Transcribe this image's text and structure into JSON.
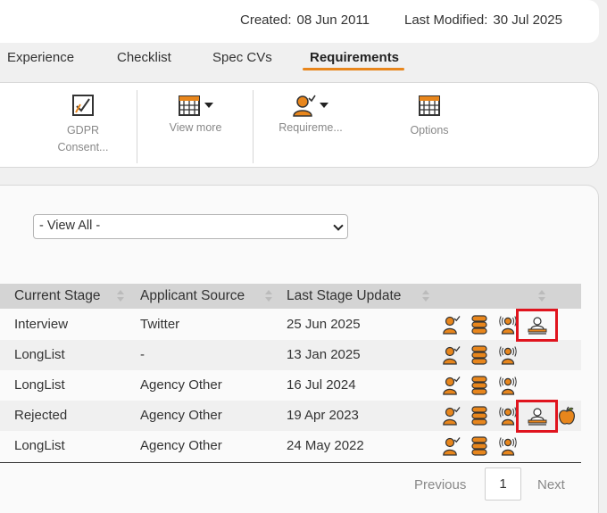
{
  "record_meta": {
    "created_label": "Created:",
    "created_value": "08 Jun 2011",
    "modified_label": "Last Modified:",
    "modified_value": "30 Jul 2025"
  },
  "tabs": [
    {
      "label": "Experience",
      "active": false
    },
    {
      "label": "Checklist",
      "active": false
    },
    {
      "label": "Spec CVs",
      "active": false
    },
    {
      "label": "Requirements",
      "active": true
    }
  ],
  "toolbar": {
    "gdpr": {
      "label1": "GDPR",
      "label2": "Consent...",
      "icon": "gdpr-consent-icon"
    },
    "view_more": {
      "label": "View more",
      "icon": "calendar-grid-icon"
    },
    "requirements": {
      "label": "Requireme...",
      "icon": "person-check-icon"
    },
    "options": {
      "label": "Options",
      "icon": "calendar-grid-icon"
    }
  },
  "filter": {
    "selected": "- View All -"
  },
  "table": {
    "columns": [
      "Current Stage",
      "Applicant Source",
      "Last Stage Update"
    ],
    "rows": [
      {
        "stage": "Interview",
        "source": "Twitter",
        "updated": "25 Jun 2025",
        "icons": [
          "person-check-icon",
          "stack-icon",
          "person-broadcast-icon",
          "person-stamp-icon"
        ],
        "highlight": true
      },
      {
        "stage": "LongList",
        "source": "-",
        "updated": "13 Jan 2025",
        "icons": [
          "person-check-icon",
          "stack-icon",
          "person-broadcast-icon"
        ],
        "highlight": false
      },
      {
        "stage": "LongList",
        "source": "Agency Other",
        "updated": "16 Jul 2024",
        "icons": [
          "person-check-icon",
          "stack-icon",
          "person-broadcast-icon"
        ],
        "highlight": false
      },
      {
        "stage": "Rejected",
        "source": "Agency Other",
        "updated": "19 Apr 2023",
        "icons": [
          "person-check-icon",
          "stack-icon",
          "person-broadcast-icon",
          "person-stamp-icon",
          "apple-icon"
        ],
        "highlight": true
      },
      {
        "stage": "LongList",
        "source": "Agency Other",
        "updated": "24 May 2022",
        "icons": [
          "person-check-icon",
          "stack-icon",
          "person-broadcast-icon"
        ],
        "highlight": false
      }
    ]
  },
  "pagination": {
    "previous": "Previous",
    "page": "1",
    "next": "Next"
  },
  "colors": {
    "accent": "#e8861c",
    "highlight": "#e0141e",
    "header_bg": "#d4d4d4"
  }
}
